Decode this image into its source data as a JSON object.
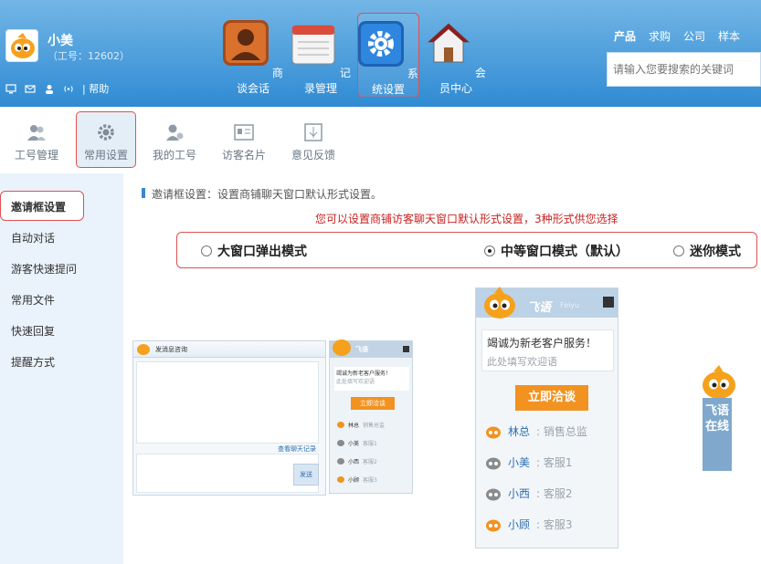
{
  "user": {
    "name": "小美",
    "id_label": "（工号：12602）"
  },
  "mini_bar": {
    "help_label": "| 帮助"
  },
  "main_nav": [
    {
      "label": "商谈会话"
    },
    {
      "label": "记录管理"
    },
    {
      "label": "系统设置"
    },
    {
      "label": "会员中心"
    }
  ],
  "top_links": [
    {
      "label": "产品"
    },
    {
      "label": "求购"
    },
    {
      "label": "公司"
    },
    {
      "label": "样本"
    }
  ],
  "search": {
    "placeholder": "请输入您要搜索的关键词"
  },
  "sub_nav": [
    {
      "label": "工号管理"
    },
    {
      "label": "常用设置"
    },
    {
      "label": "我的工号"
    },
    {
      "label": "访客名片"
    },
    {
      "label": "意见反馈"
    }
  ],
  "sidebar": {
    "items": [
      {
        "label": "邀请框设置"
      },
      {
        "label": "自动对话"
      },
      {
        "label": "游客快速提问"
      },
      {
        "label": "常用文件"
      },
      {
        "label": "快速回复"
      },
      {
        "label": "提醒方式"
      }
    ]
  },
  "main": {
    "intro": "邀请框设置：设置商铺聊天窗口默认形式设置。",
    "tip": "您可以设置商铺访客聊天窗口默认形式设置，3种形式供您选择",
    "modes": [
      {
        "label": "大窗口弹出模式",
        "checked": false
      },
      {
        "label": "中等窗口模式（默认）",
        "checked": true
      },
      {
        "label": "迷你模式",
        "checked": false
      }
    ]
  },
  "large_preview": {
    "title": "发消息咨询",
    "history_link": "查看聊天记录",
    "send_label": "发送"
  },
  "small_preview": {
    "logo": "飞语",
    "greeting": "竭诚为新老客户服务！",
    "welcome": "此处填写欢迎语",
    "chat_button": "立即洽谈",
    "agents": [
      {
        "name": "林总",
        "role": "销售总监"
      },
      {
        "name": "小美",
        "role": "客服1"
      },
      {
        "name": "小西",
        "role": "客服2"
      },
      {
        "name": "小顾",
        "role": "客服3"
      }
    ]
  },
  "medium_preview": {
    "logo": "飞语",
    "logo_sub": "Feiyu",
    "greeting": "竭诚为新老客户服务！",
    "welcome": "此处填写欢迎语",
    "chat_button": "立即洽谈",
    "agents": [
      {
        "name": "林总",
        "role": ": 销售总监"
      },
      {
        "name": "小美",
        "role": ": 客服1"
      },
      {
        "name": "小西",
        "role": ": 客服2"
      },
      {
        "name": "小顾",
        "role": ": 客服3"
      }
    ]
  },
  "float_widget": {
    "label": "飞语在线"
  },
  "colors": {
    "header_top": "#73b6e6",
    "header_bottom": "#2f8bd3",
    "highlight_border": "#e05050",
    "accent_orange": "#f29221",
    "tip_red": "#c82121",
    "sidebar_bg": "#eaf3fb"
  }
}
